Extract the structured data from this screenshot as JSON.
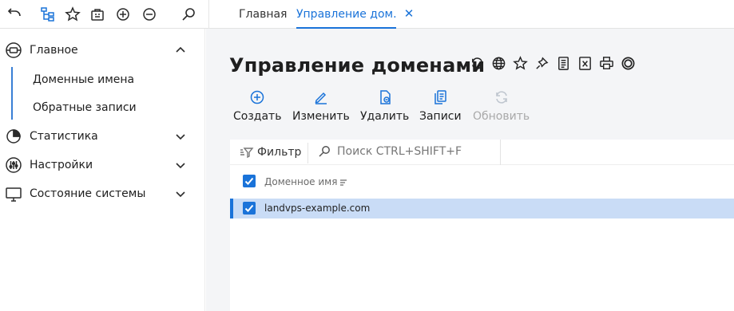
{
  "topbar": {
    "icons": [
      "back-arrow-icon",
      "tree-icon",
      "star-icon",
      "briefcase-icon",
      "plus-circle-icon",
      "minus-circle-icon",
      "search-icon"
    ],
    "tabs": [
      {
        "label": "Главная",
        "active": false
      },
      {
        "label": "Управление дом...",
        "active": true
      }
    ],
    "close_glyph": "✕"
  },
  "sidebar": {
    "sections": [
      {
        "label": "Главное",
        "icon": "dashboard-icon",
        "expanded": true
      },
      {
        "label": "Статистика",
        "icon": "pie-chart-icon",
        "expanded": false
      },
      {
        "label": "Настройки",
        "icon": "sliders-icon",
        "expanded": false
      },
      {
        "label": "Состояние системы",
        "icon": "monitor-icon",
        "expanded": false
      }
    ],
    "subitems": [
      {
        "label": "Доменные имена",
        "active": true
      },
      {
        "label": "Обратные записи",
        "active": false
      }
    ]
  },
  "main": {
    "title": "Управление доменами",
    "title_icons": [
      "refresh-icon",
      "globe-icon",
      "star-icon",
      "pin-icon",
      "document-icon",
      "excel-icon",
      "print-icon",
      "circle-icon"
    ],
    "toolbar": [
      {
        "label": "Создать",
        "icon": "plus-circle-icon",
        "enabled": true
      },
      {
        "label": "Изменить",
        "icon": "pencil-icon",
        "enabled": true
      },
      {
        "label": "Удалить",
        "icon": "delete-file-icon",
        "enabled": true
      },
      {
        "label": "Записи",
        "icon": "records-icon",
        "enabled": true
      },
      {
        "label": "Обновить",
        "icon": "refresh-icon",
        "enabled": false
      }
    ],
    "filter_label": "Фильтр",
    "search_placeholder": "Поиск CTRL+SHIFT+F",
    "columns": [
      {
        "label": "Доменное имя",
        "sort": "sort-icon"
      }
    ],
    "rows": [
      {
        "name": "landvps-example.com",
        "selected": true
      }
    ]
  },
  "colors": {
    "accent": "#1a73d9",
    "selected_row": "#c9dcf6",
    "main_bg": "#f4f5f7"
  }
}
